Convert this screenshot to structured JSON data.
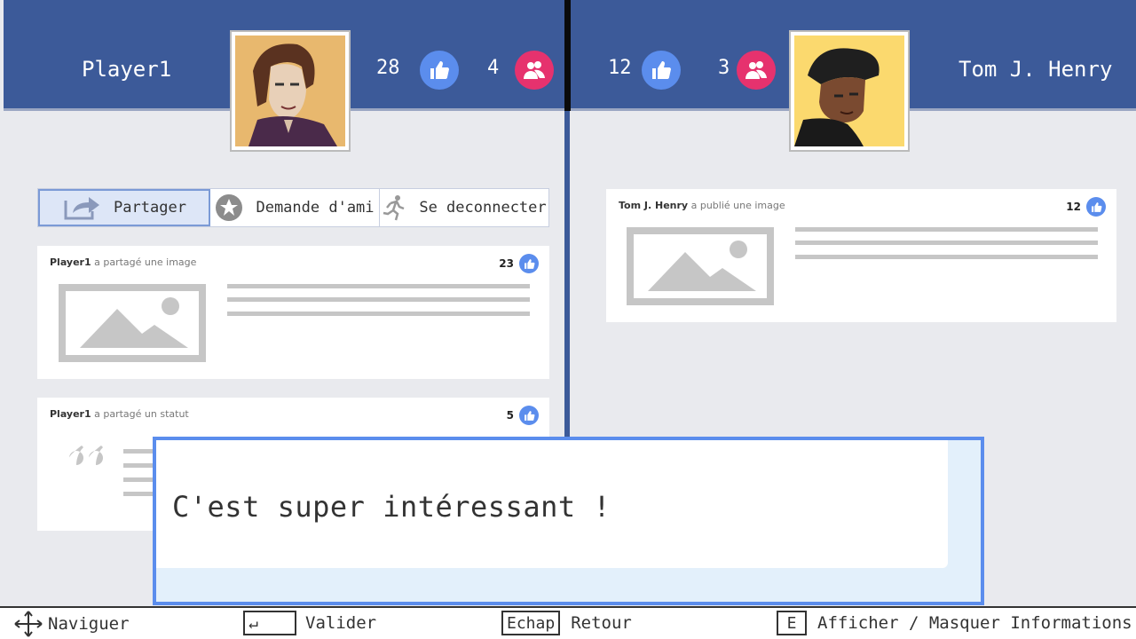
{
  "left_profile": {
    "name": "Player1",
    "likes": "28",
    "friends": "4"
  },
  "right_profile": {
    "name": "Tom J. Henry",
    "likes": "12",
    "friends": "3"
  },
  "tabs": [
    {
      "label": "Partager",
      "icon": "share-icon",
      "active": true
    },
    {
      "label": "Demande d'ami",
      "icon": "star-icon",
      "active": false
    },
    {
      "label": "Se deconnecter",
      "icon": "running-man-icon",
      "active": false
    }
  ],
  "left_posts": [
    {
      "author": "Player1",
      "action": "a partagé une image",
      "likes": "23"
    },
    {
      "author": "Player1",
      "action": "a partagé un statut",
      "likes": "5"
    }
  ],
  "right_posts": [
    {
      "author": "Tom J. Henry",
      "action": "a publié une image",
      "likes": "12"
    }
  ],
  "dialog": {
    "text": "C'est super intéressant !"
  },
  "footer": {
    "navigate": "Naviguer",
    "validate_key": "↵",
    "validate": "Valider",
    "back_key": "Echap",
    "back": "Retour",
    "info_key": "E",
    "info": "Afficher / Masquer Informations"
  },
  "colors": {
    "header_blue": "#3c5a99",
    "like_blue": "#5b8ded",
    "friend_pink": "#e6326e"
  }
}
